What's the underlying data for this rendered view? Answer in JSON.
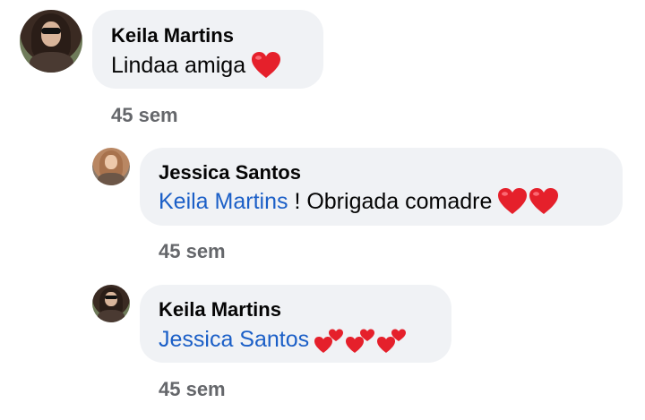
{
  "comments": [
    {
      "author": "Keila Martins",
      "message": "Lindaa amiga",
      "emoji": "red-heart-icon",
      "time": "45 sem"
    },
    {
      "author": "Jessica Santos",
      "mention": "Keila Martins",
      "message": " ! Obrigada comadre",
      "emoji": "red-heart-icon x2",
      "time": "45 sem"
    },
    {
      "author": "Keila Martins",
      "mention": "Jessica Santos",
      "message": "",
      "emoji": "two-hearts-icon x3",
      "time": "45 sem"
    }
  ],
  "colors": {
    "bubble": "#f0f2f5",
    "mention": "#1b5fc7",
    "timestamp": "#65676b",
    "heart": "#e5202b"
  }
}
